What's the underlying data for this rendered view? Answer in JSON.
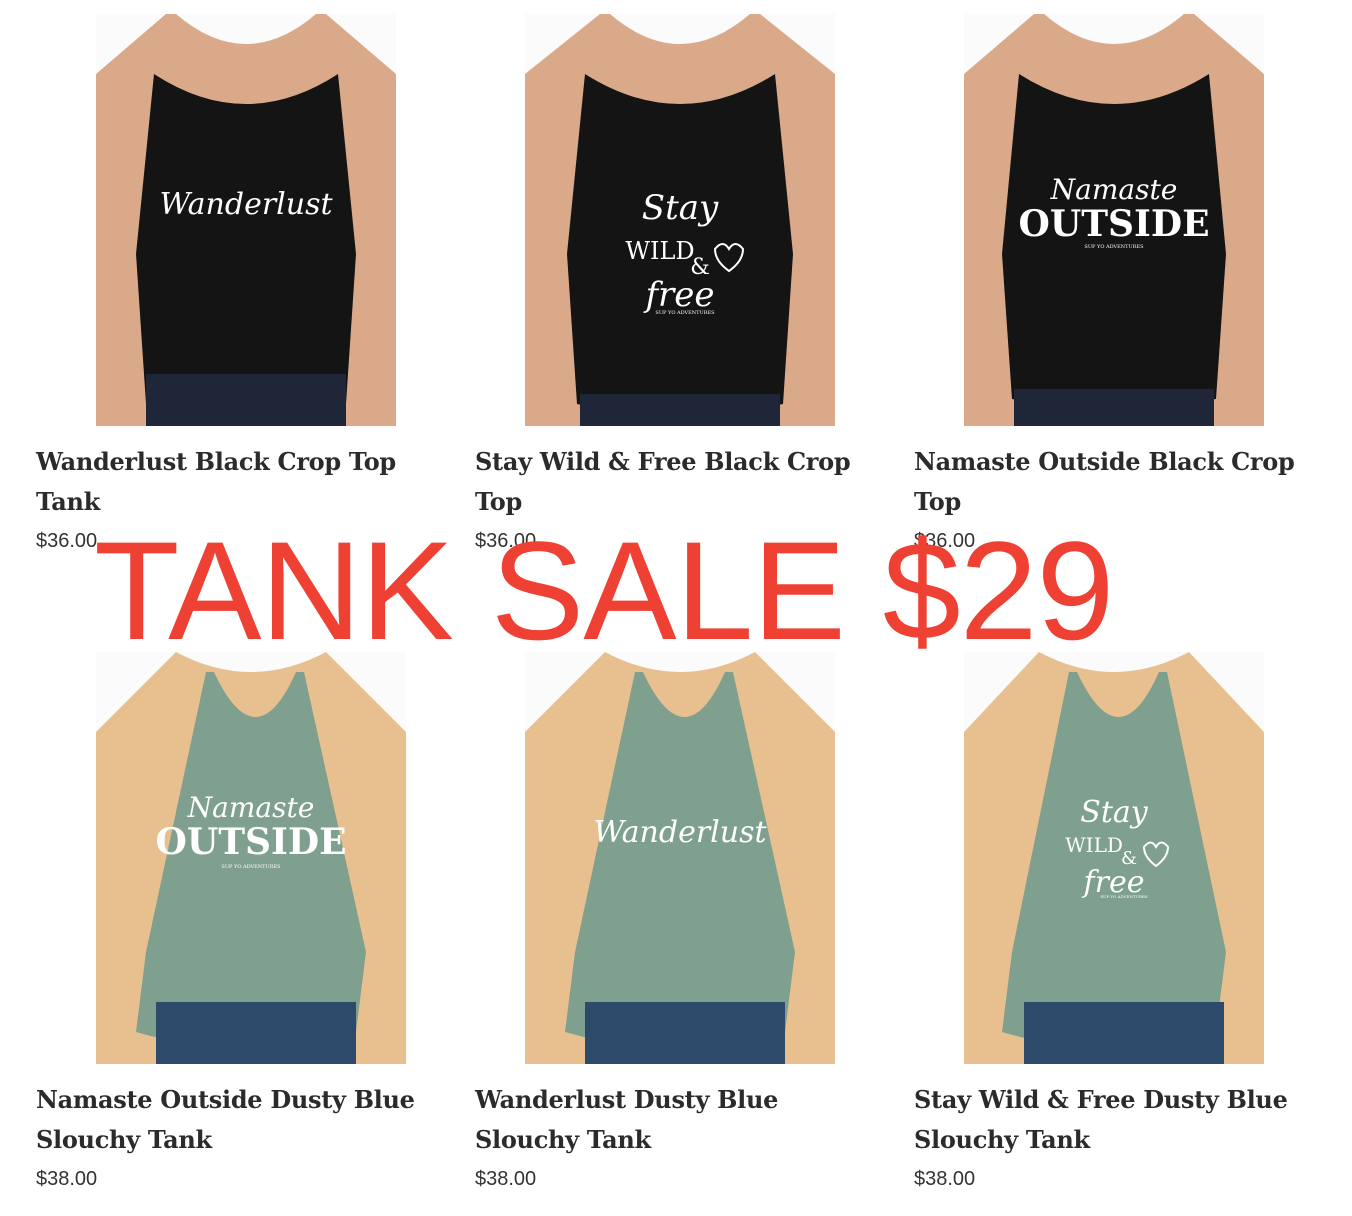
{
  "banner": {
    "text": "TANK SALE $29",
    "color": "#ef4133"
  },
  "products": [
    {
      "title_line1": "Wanderlust Black Crop Top",
      "title_line2": "Tank",
      "price": "$36.00",
      "shirt_color": "#141414",
      "print": [
        "Wanderlust"
      ]
    },
    {
      "title_line1": "Stay Wild & Free Black Crop",
      "title_line2": "Top",
      "price": "$36.00",
      "shirt_color": "#141414",
      "print": [
        "Stay",
        "WILD",
        "&",
        "free",
        "SUP YO ADVENTURES"
      ]
    },
    {
      "title_line1": "Namaste Outside Black Crop",
      "title_line2": "Top",
      "price": "$36.00",
      "shirt_color": "#141414",
      "print": [
        "Namaste",
        "OUTSIDE",
        "SUP YO ADVENTURES"
      ]
    },
    {
      "title_line1": "Namaste Outside Dusty Blue",
      "title_line2": "Slouchy Tank",
      "price": "$38.00",
      "shirt_color": "#7fa08f",
      "print": [
        "Namaste",
        "OUTSIDE",
        "SUP YO ADVENTURES"
      ]
    },
    {
      "title_line1": "Wanderlust Dusty Blue",
      "title_line2": "Slouchy Tank",
      "price": "$38.00",
      "shirt_color": "#7fa08f",
      "print": [
        "Wanderlust"
      ]
    },
    {
      "title_line1": "Stay Wild & Free Dusty Blue",
      "title_line2": "Slouchy Tank",
      "price": "$38.00",
      "shirt_color": "#7fa08f",
      "print": [
        "Stay",
        "WILD",
        "&",
        "free",
        "SUP YO ADVENTURES"
      ]
    }
  ]
}
